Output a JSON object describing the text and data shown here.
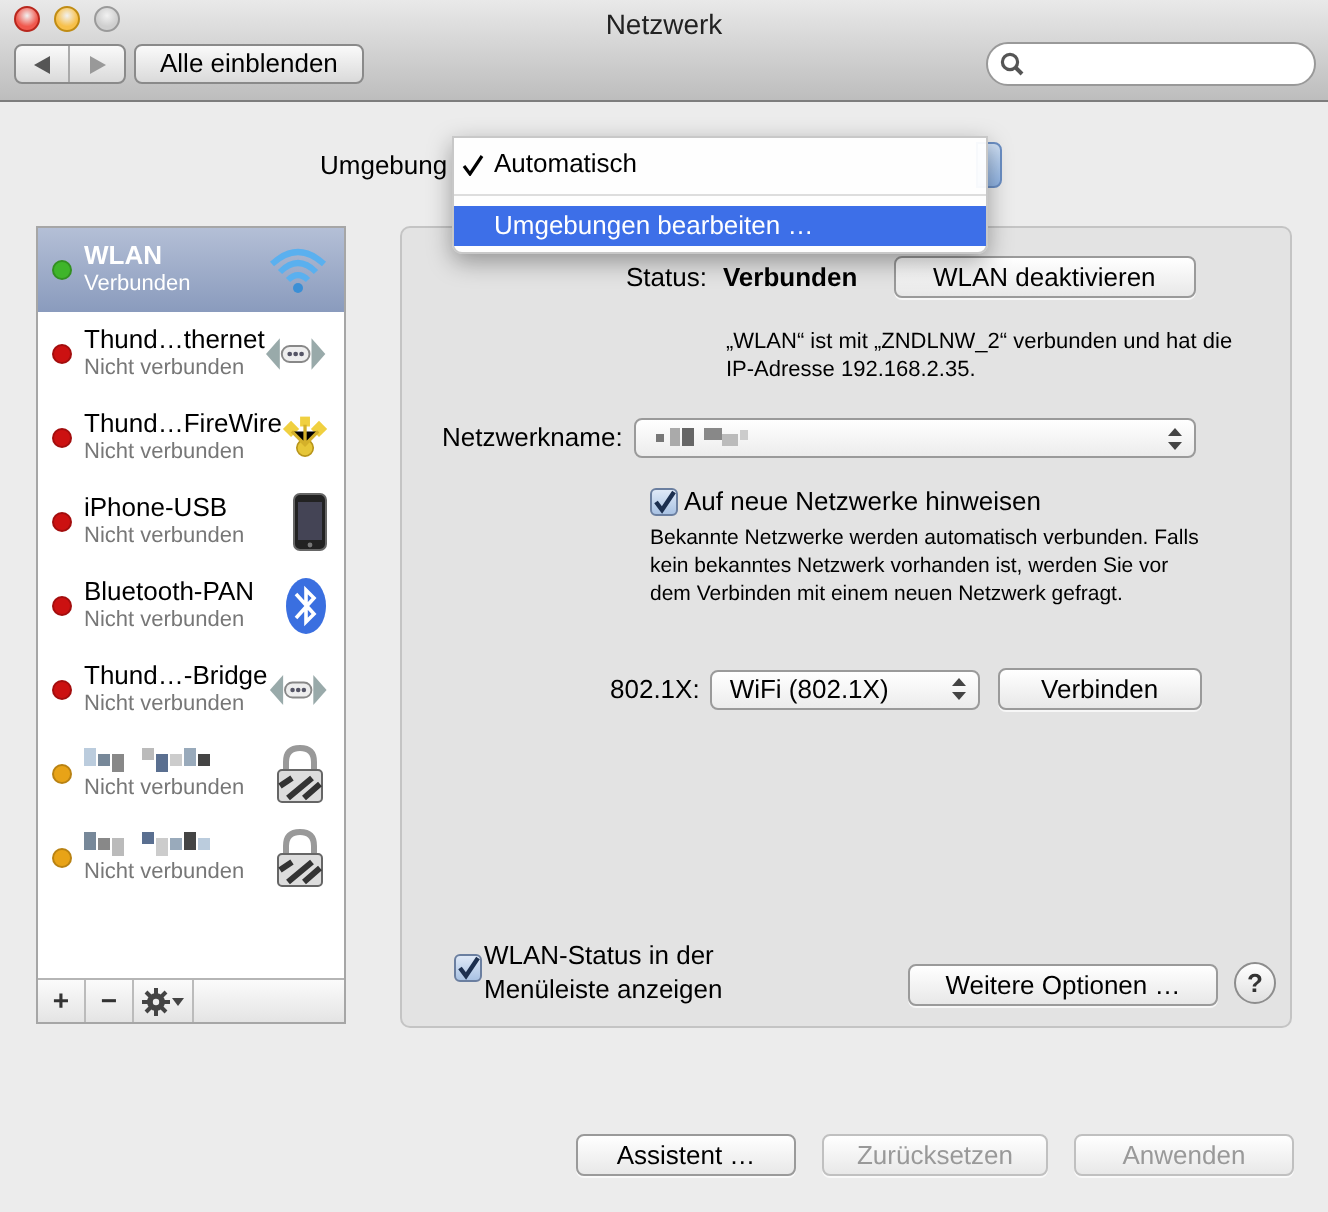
{
  "window": {
    "title": "Netzwerk"
  },
  "toolbar": {
    "show_all_button": "Alle einblenden"
  },
  "location": {
    "label": "Umgebung",
    "menu": [
      {
        "label": "Automatisch",
        "checked": true,
        "selected": false
      },
      {
        "label": "Umgebungen bearbeiten …",
        "checked": false,
        "selected": true
      }
    ]
  },
  "services": [
    {
      "kind": "wifi",
      "name": "WLAN",
      "status": "Verbunden",
      "color": "#3fb52a",
      "selected": true
    },
    {
      "kind": "ethernet",
      "name": "Thund…thernet",
      "status": "Nicht verbunden",
      "color": "#cc1111",
      "selected": false
    },
    {
      "kind": "firewire",
      "name": "Thund…FireWire",
      "status": "Nicht verbunden",
      "color": "#cc1111",
      "selected": false
    },
    {
      "kind": "phone",
      "name": "iPhone-USB",
      "status": "Nicht verbunden",
      "color": "#cc1111",
      "selected": false
    },
    {
      "kind": "bluetooth",
      "name": "Bluetooth-PAN",
      "status": "Nicht verbunden",
      "color": "#cc1111",
      "selected": false
    },
    {
      "kind": "ethernet",
      "name": "Thund…-Bridge",
      "status": "Nicht verbunden",
      "color": "#cc1111",
      "selected": false
    },
    {
      "kind": "vpn",
      "status": "Nicht verbunden",
      "color": "#e8a317",
      "selected": false
    },
    {
      "kind": "vpn",
      "status": "Nicht verbunden",
      "color": "#e8a317",
      "selected": false
    }
  ],
  "list_buttons": [
    "+",
    "−"
  ],
  "detail": {
    "status_label": "Status:",
    "status_value": "Verbunden",
    "toggle_button": "WLAN deaktivieren",
    "status_description": "„WLAN“ ist mit „ZNDLNW_2“ verbunden und hat die IP-Adresse 192.168.2.35.",
    "network_name_label": "Netzwerkname:",
    "ask_new": {
      "label": "Auf neue Netzwerke hinweisen",
      "checked": true
    },
    "ask_new_help": "Bekannte Netzwerke werden automatisch verbunden. Falls kein bekanntes Netzwerk vorhanden ist, werden Sie vor dem Verbinden mit einem neuen Netzwerk gefragt.",
    "dot1x_label": "802.1X:",
    "dot1x_value": "WiFi (802.1X)",
    "connect_button": "Verbinden",
    "menubar_status": {
      "label": "WLAN-Status in der Menüleiste anzeigen",
      "checked": true
    },
    "advanced_button": "Weitere Optionen …",
    "help_button": "?"
  },
  "footer_buttons": [
    {
      "label": "Assistent …",
      "disabled": false
    },
    {
      "label": "Zurücksetzen",
      "disabled": true
    },
    {
      "label": "Anwenden",
      "disabled": true
    }
  ]
}
